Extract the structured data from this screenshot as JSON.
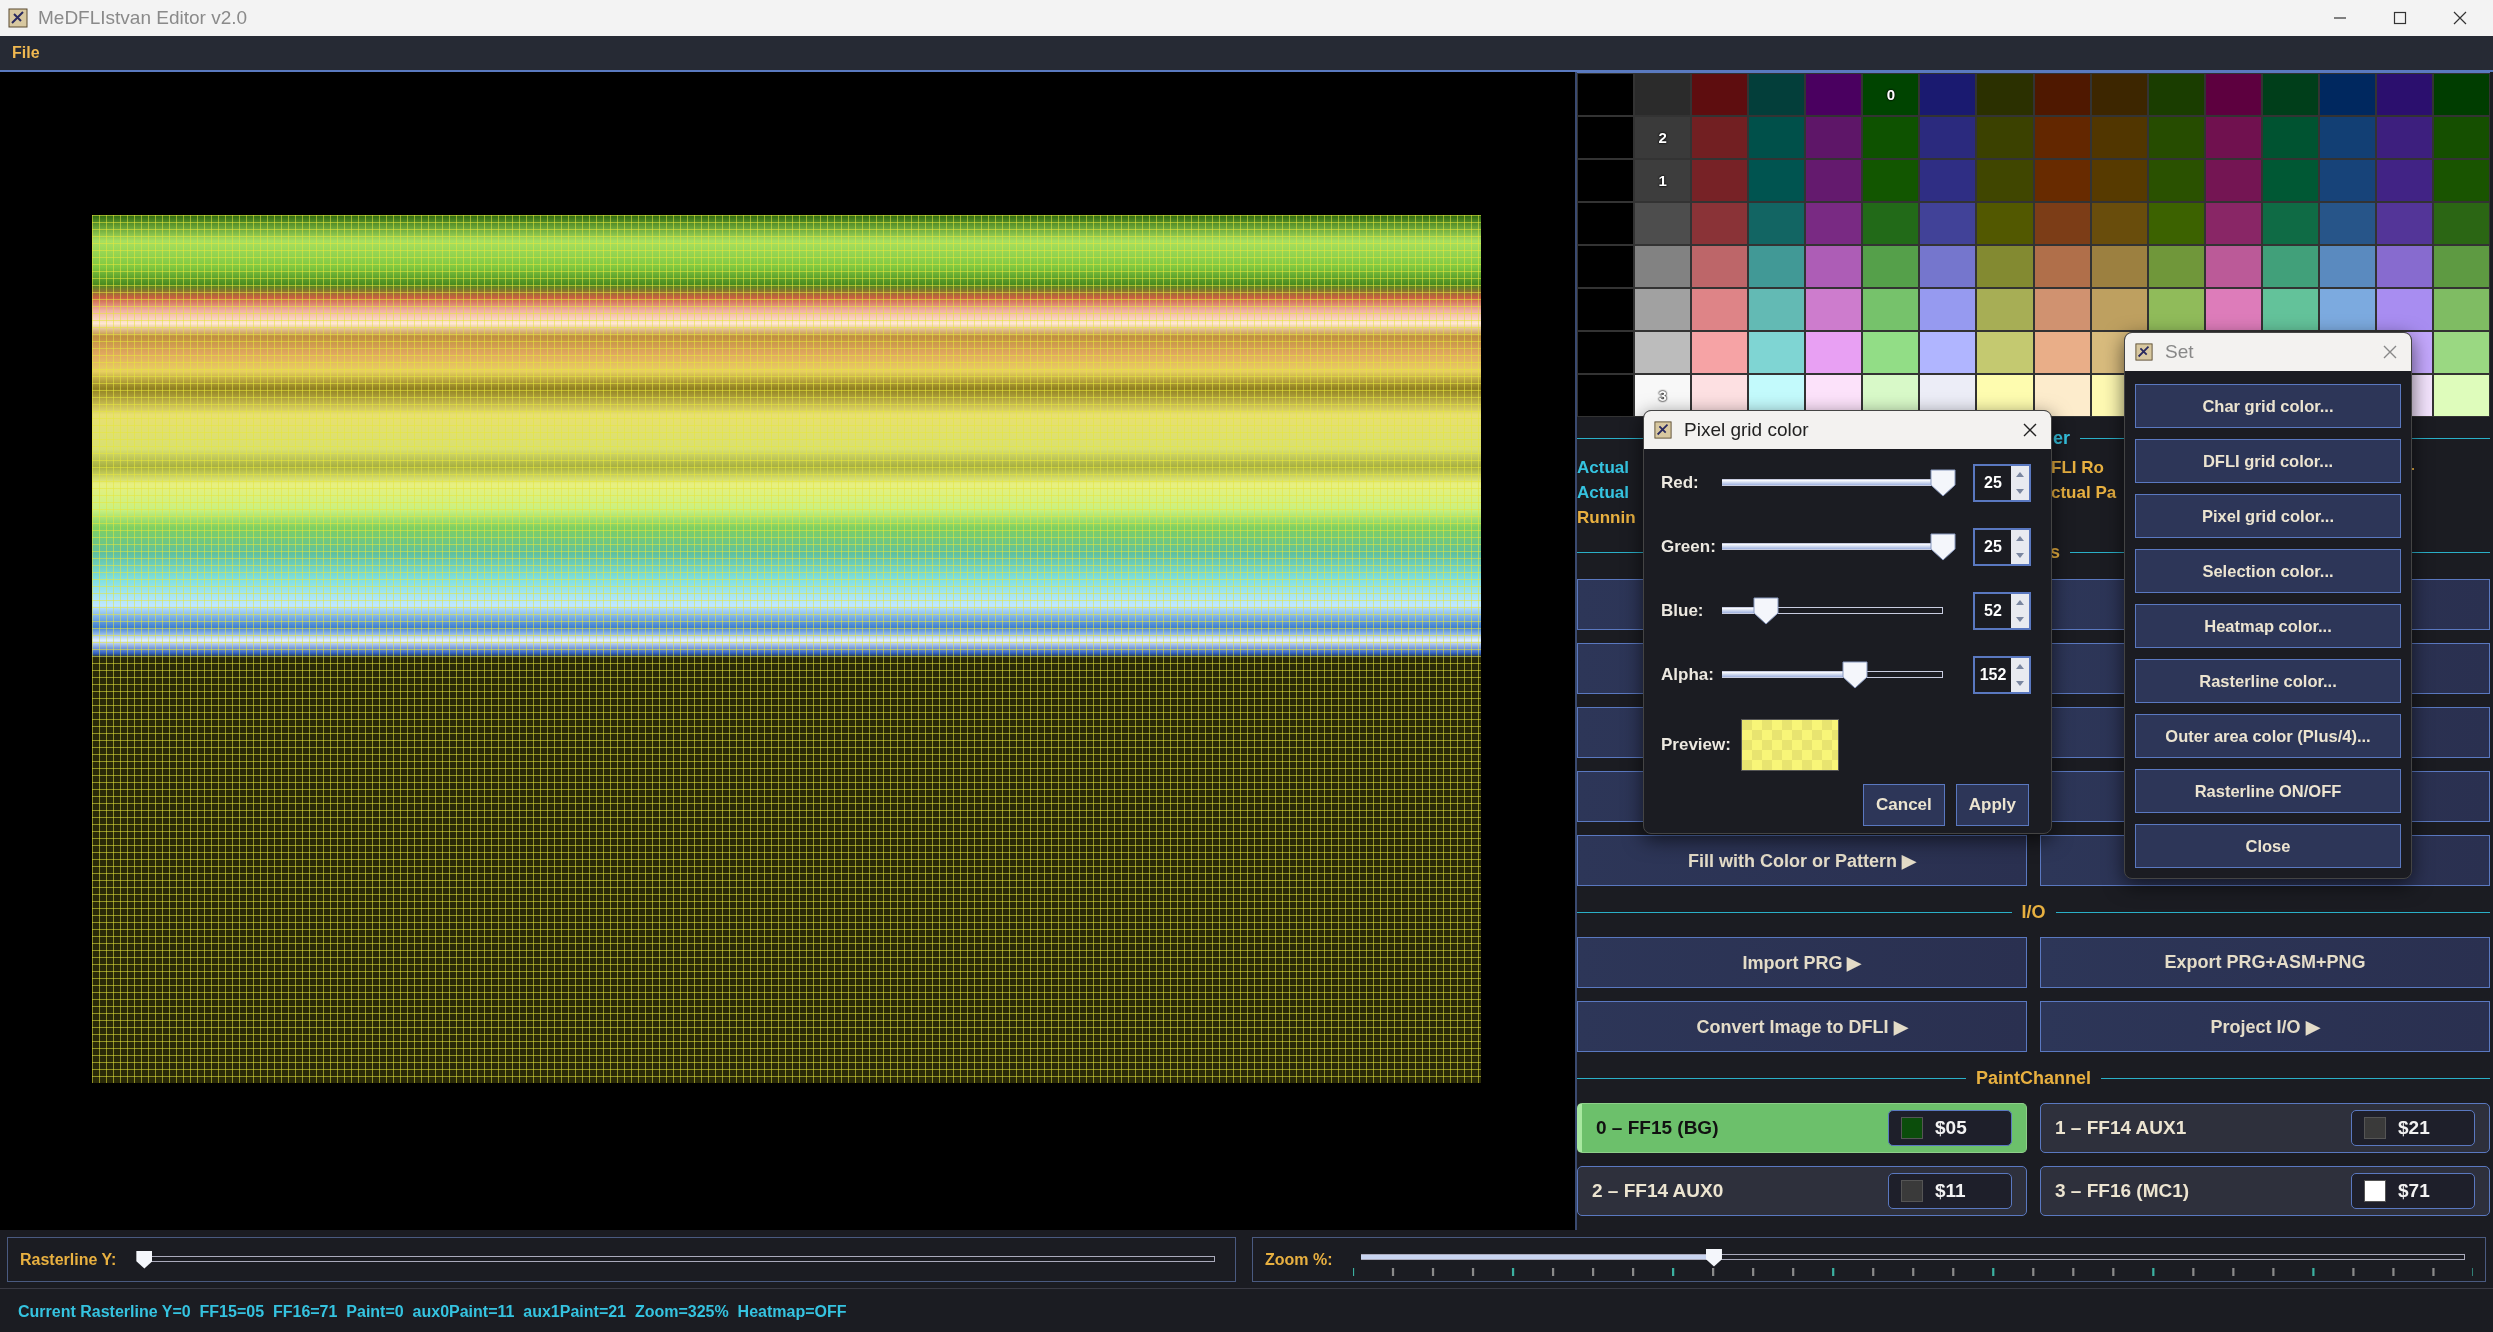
{
  "window": {
    "title": "MeDFLIstvan Editor v2.0"
  },
  "menu": [
    "File"
  ],
  "palette": {
    "rows": [
      {
        "cells": [
          {
            "color": "#000000"
          },
          {
            "color": "#2b2b2b"
          },
          {
            "color": "#5e0d0f"
          },
          {
            "color": "#033e3a"
          },
          {
            "color": "#4a0060"
          },
          {
            "color": "#004400",
            "label": "0"
          },
          {
            "color": "#1a1a70"
          },
          {
            "color": "#2b3000"
          },
          {
            "color": "#4f1800"
          },
          {
            "color": "#3d2600"
          },
          {
            "color": "#1a3d00"
          },
          {
            "color": "#5d003f"
          },
          {
            "color": "#003e1a"
          },
          {
            "color": "#00285f"
          },
          {
            "color": "#2b0f6e"
          },
          {
            "color": "#003d00"
          }
        ]
      },
      {
        "cells": [
          {
            "color": "#000000"
          },
          {
            "color": "#3a3a3a",
            "label": "2"
          },
          {
            "color": "#721f22"
          },
          {
            "color": "#00504a"
          },
          {
            "color": "#5e1668"
          },
          {
            "color": "#0e5200"
          },
          {
            "color": "#2b2a7e"
          },
          {
            "color": "#3b4100"
          },
          {
            "color": "#632700"
          },
          {
            "color": "#513600"
          },
          {
            "color": "#264c00"
          },
          {
            "color": "#70114f"
          },
          {
            "color": "#005331"
          },
          {
            "color": "#123f74"
          },
          {
            "color": "#3d1f7e"
          },
          {
            "color": "#154f00"
          }
        ]
      },
      {
        "cells": [
          {
            "color": "#000000"
          },
          {
            "color": "#3d3d3d",
            "label": "1"
          },
          {
            "color": "#772226"
          },
          {
            "color": "#005450"
          },
          {
            "color": "#641a6e"
          },
          {
            "color": "#125600"
          },
          {
            "color": "#2f2e84"
          },
          {
            "color": "#404600"
          },
          {
            "color": "#682b00"
          },
          {
            "color": "#573a00"
          },
          {
            "color": "#2a5100"
          },
          {
            "color": "#741553"
          },
          {
            "color": "#005834"
          },
          {
            "color": "#174379"
          },
          {
            "color": "#412385"
          },
          {
            "color": "#195400"
          }
        ]
      },
      {
        "cells": [
          {
            "color": "#000000"
          },
          {
            "color": "#4d4d4d"
          },
          {
            "color": "#8a3337"
          },
          {
            "color": "#126563"
          },
          {
            "color": "#792a83"
          },
          {
            "color": "#226a18"
          },
          {
            "color": "#414298"
          },
          {
            "color": "#525800"
          },
          {
            "color": "#7c3d17"
          },
          {
            "color": "#694d0c"
          },
          {
            "color": "#3c6200"
          },
          {
            "color": "#892666"
          },
          {
            "color": "#0f6b45"
          },
          {
            "color": "#275589"
          },
          {
            "color": "#533598"
          },
          {
            "color": "#2b6614"
          }
        ]
      },
      {
        "cells": [
          {
            "color": "#000000"
          },
          {
            "color": "#828282"
          },
          {
            "color": "#bd6669"
          },
          {
            "color": "#419996"
          },
          {
            "color": "#ad5db6"
          },
          {
            "color": "#55a04a"
          },
          {
            "color": "#7576cd"
          },
          {
            "color": "#838a31"
          },
          {
            "color": "#b06f4a"
          },
          {
            "color": "#9c8040"
          },
          {
            "color": "#70973a"
          },
          {
            "color": "#bb5a98"
          },
          {
            "color": "#41a07a"
          },
          {
            "color": "#5a8abf"
          },
          {
            "color": "#876bcf"
          },
          {
            "color": "#5e9a42"
          }
        ]
      },
      {
        "cells": [
          {
            "color": "#000000"
          },
          {
            "color": "#a1a1a1"
          },
          {
            "color": "#de8487"
          },
          {
            "color": "#63bab4"
          },
          {
            "color": "#cd7ccd"
          },
          {
            "color": "#76c26b"
          },
          {
            "color": "#969af0"
          },
          {
            "color": "#a7ae55"
          },
          {
            "color": "#d09270"
          },
          {
            "color": "#bea060"
          },
          {
            "color": "#90bb5a"
          },
          {
            "color": "#dd7cba"
          },
          {
            "color": "#63c29a"
          },
          {
            "color": "#7caadf"
          },
          {
            "color": "#a88df1"
          },
          {
            "color": "#7fbc63"
          }
        ]
      },
      {
        "cells": [
          {
            "color": "#000000"
          },
          {
            "color": "#bcbcbc"
          },
          {
            "color": "#f6a3a5"
          },
          {
            "color": "#7fd5d3"
          },
          {
            "color": "#e8a0f3"
          },
          {
            "color": "#92dd86"
          },
          {
            "color": "#b0b5ff"
          },
          {
            "color": "#c4c970"
          },
          {
            "color": "#e9ae88"
          },
          {
            "color": "#d8bb7d"
          },
          {},
          {},
          {},
          {},
          {
            "color": "#c3a7fc"
          },
          {
            "color": "#9ad882"
          }
        ]
      },
      {
        "cells": [
          {
            "color": "#000000"
          },
          {
            "color": "#f8f8f8",
            "label": "3"
          },
          {
            "color": "#fde0e2"
          },
          {
            "color": "#c3fafc"
          },
          {
            "color": "#fce2fa"
          },
          {
            "color": "#d8f9c8"
          },
          {
            "color": "#ecedf7"
          },
          {
            "color": "#fefcaf"
          },
          {
            "color": "#fdeccc"
          },
          {
            "color": "#fef9b2"
          },
          {},
          {},
          {},
          {},
          {
            "color": "#f3e3fd"
          },
          {
            "color": "#defcbb"
          }
        ]
      }
    ]
  },
  "info": {
    "header": "er",
    "left_lines": [
      {
        "text": "Actual",
        "kind": "value"
      },
      {
        "text": "Actual",
        "kind": "value"
      },
      {
        "text": "Runnin",
        "kind": "status"
      }
    ],
    "right_lines": [
      {
        "text": "FLI Ro",
        "kind": "status"
      },
      {
        "text": "ctual Pa",
        "kind": "status"
      }
    ],
    "far_right": "-"
  },
  "tools": {
    "header": "s",
    "fill_button": "Fill with Color or Pattern ▶"
  },
  "io": {
    "header": "I/O",
    "buttons": [
      "Import PRG ▶",
      "Export PRG+ASM+PNG",
      "Convert Image to DFLI ▶",
      "Project I/O ▶"
    ]
  },
  "paint_channel": {
    "header": "PaintChannel",
    "channels": [
      {
        "label": "0 – FF15 (BG)",
        "value": "$05",
        "color": "#0b4d0b",
        "selected": true
      },
      {
        "label": "1 – FF14 AUX1",
        "value": "$21",
        "color": "#3a3a3a",
        "selected": false
      },
      {
        "label": "2 – FF14 AUX0",
        "value": "$11",
        "color": "#3a3a3a",
        "selected": false
      },
      {
        "label": "3 – FF16 (MC1)",
        "value": "$71",
        "color": "#ffffff",
        "selected": false
      }
    ]
  },
  "rasterline": {
    "label": "Rasterline Y:",
    "level": 0
  },
  "zoom": {
    "label": "Zoom %:",
    "level": 0.32
  },
  "status_bar": "Current Rasterline Y=0  FF15=05  FF16=71  Paint=0  aux0Paint=11  aux1Paint=21  Zoom=325%  Heatmap=OFF",
  "pixel_dialog": {
    "title": "Pixel grid color",
    "sliders": [
      {
        "label": "Red:",
        "level": 1,
        "value": "25"
      },
      {
        "label": "Green:",
        "level": 1,
        "value": "25"
      },
      {
        "label": "Blue:",
        "level": 0.2,
        "value": "52"
      },
      {
        "label": "Alpha:",
        "level": 0.6,
        "value": "152"
      }
    ],
    "preview_label": "Preview:",
    "buttons": [
      "Cancel",
      "Apply"
    ]
  },
  "set_dialog": {
    "title": "Set",
    "buttons": [
      "Char grid color...",
      "DFLI grid color...",
      "Pixel grid color...",
      "Selection color...",
      "Heatmap color...",
      "Rasterline color...",
      "Outer area color (Plus/4)...",
      "Rasterline ON/OFF",
      "Close"
    ]
  }
}
